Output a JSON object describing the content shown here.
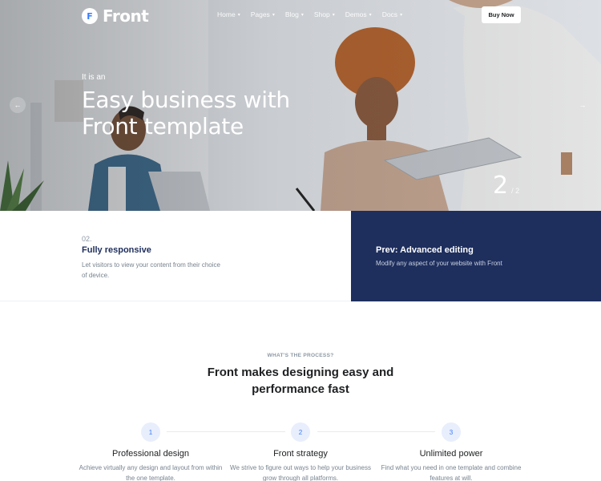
{
  "brand": {
    "logo_letter": "F",
    "name": "Front"
  },
  "nav": {
    "items": [
      {
        "label": "Home"
      },
      {
        "label": "Pages"
      },
      {
        "label": "Blog"
      },
      {
        "label": "Shop"
      },
      {
        "label": "Demos"
      },
      {
        "label": "Docs"
      }
    ],
    "cta_label": "Buy Now"
  },
  "hero": {
    "kicker": "It is an",
    "title": "Easy business with Front template",
    "prev_arrow": "←",
    "next_arrow": "→",
    "slide_current": "2",
    "slide_total": "/ 2"
  },
  "info": {
    "step_number": "02.",
    "step_title": "Fully responsive",
    "step_desc": "Let visitors to view your content from their choice of device.",
    "prev_title": "Prev: Advanced editing",
    "prev_desc": "Modify any aspect of your website with Front"
  },
  "process": {
    "kicker": "WHAT'S THE PROCESS?",
    "title": "Front makes designing easy and performance fast",
    "steps": [
      {
        "number": "1",
        "title": "Professional design",
        "desc": "Achieve virtually any design and layout from within the one template."
      },
      {
        "number": "2",
        "title": "Front strategy",
        "desc": "We strive to figure out ways to help your business grow through all platforms."
      },
      {
        "number": "3",
        "title": "Unlimited power",
        "desc": "Find what you need in one template and combine features at will."
      }
    ]
  },
  "colors": {
    "accent": "#377dff",
    "navy": "#1e2f5e",
    "text_muted": "#77838f"
  },
  "icons": {
    "prev": "arrow-left-icon",
    "next": "arrow-right-icon",
    "caret": "chevron-down-icon"
  }
}
